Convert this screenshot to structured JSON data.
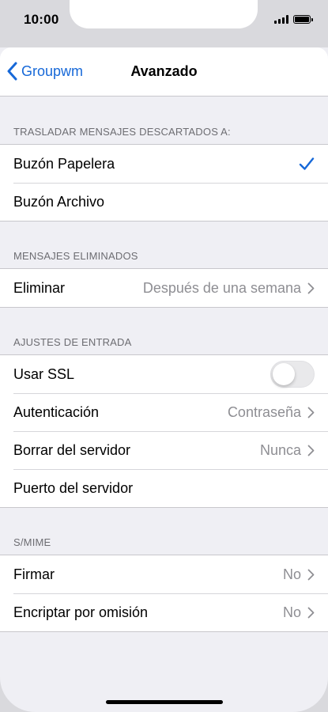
{
  "status_bar": {
    "time": "10:00"
  },
  "nav": {
    "back_label": "Groupwm",
    "title": "Avanzado"
  },
  "sections": [
    {
      "header": "TRASLADAR MENSAJES DESCARTADOS A:",
      "rows": [
        {
          "label": "Buzón Papelera",
          "selected": true
        },
        {
          "label": "Buzón Archivo",
          "selected": false
        }
      ]
    },
    {
      "header": "MENSAJES ELIMINADOS",
      "rows": [
        {
          "label": "Eliminar",
          "value": "Después de una semana"
        }
      ]
    },
    {
      "header": "AJUSTES DE ENTRADA",
      "rows": [
        {
          "label": "Usar SSL",
          "toggle": false
        },
        {
          "label": "Autenticación",
          "value": "Contraseña"
        },
        {
          "label": "Borrar del servidor",
          "value": "Nunca"
        },
        {
          "label": "Puerto del servidor"
        }
      ]
    },
    {
      "header": "S/MIME",
      "rows": [
        {
          "label": "Firmar",
          "value": "No"
        },
        {
          "label": "Encriptar por omisión",
          "value": "No"
        }
      ]
    }
  ],
  "colors": {
    "accent": "#1668d8",
    "background": "#efeff4",
    "secondary_text": "#8e8e93"
  }
}
